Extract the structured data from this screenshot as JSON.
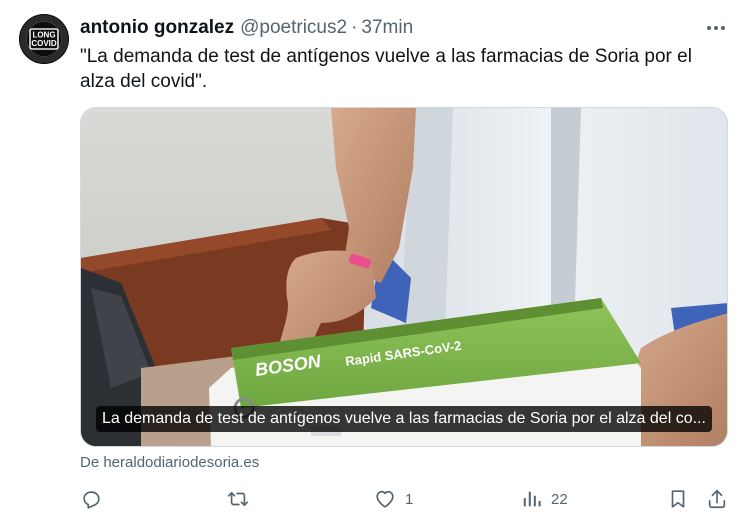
{
  "author": {
    "name": "antonio gonzalez",
    "handle": "@poetricus2",
    "separator": "·",
    "time": "37min",
    "avatar": {
      "line1": "LONG",
      "line2": "COVID"
    }
  },
  "tweet": {
    "text": "\"La demanda de test de antígenos vuelve a las farmacias de Soria por el alza del covid\"."
  },
  "card": {
    "caption": "La demanda de test de antígenos vuelve a las farmacias de Soria por el alza del co...",
    "photo_box_brand": "BOSON",
    "photo_box_product": "Rapid SARS-CoV-2",
    "source_label": "De heraldodiariodesoria.es"
  },
  "actions": {
    "reply_count": "",
    "retweet_count": "",
    "like_count": "1",
    "views_count": "22"
  },
  "icons": {
    "more": "more-icon",
    "reply": "reply-icon",
    "retweet": "retweet-icon",
    "like": "heart-icon",
    "views": "views-icon",
    "bookmark": "bookmark-icon",
    "share": "share-icon"
  },
  "colors": {
    "text_primary": "#0f1419",
    "text_secondary": "#536471",
    "border": "#cfd9de"
  }
}
